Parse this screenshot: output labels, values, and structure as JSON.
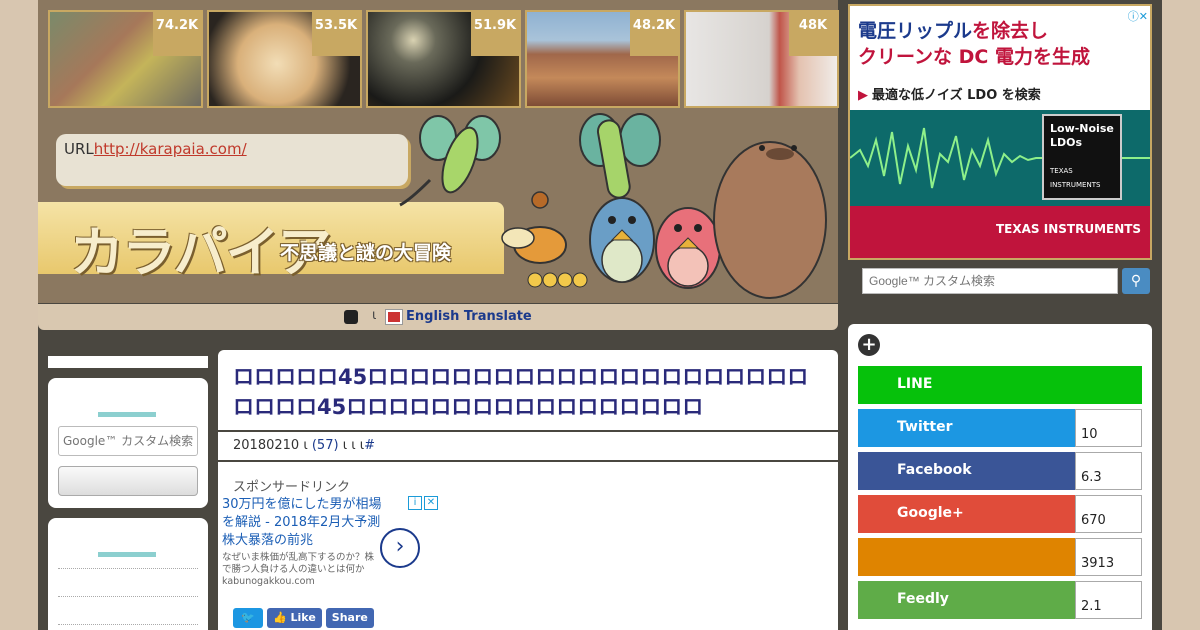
{
  "thumbs": [
    {
      "count": "74.2K",
      "icon": "street-photo"
    },
    {
      "count": "53.5K",
      "icon": "dog-photo"
    },
    {
      "count": "51.9K",
      "icon": "city-night-photo"
    },
    {
      "count": "48.2K",
      "icon": "canyon-photo"
    },
    {
      "count": "48K",
      "icon": "hand-device-photo"
    }
  ],
  "url_box": {
    "prefix": "URL",
    "link": "http://karapaia.com/"
  },
  "logo": {
    "title": "カラパイア",
    "tagline": "不思議と謎の大冒険"
  },
  "translate": {
    "separator": "ι",
    "label": "English Translate"
  },
  "left_sidebar": {
    "search_placeholder": "Google™ カスタム検索"
  },
  "article": {
    "title": "ロロロロロ45ロロロロロロロロロロロロロロロロロロロロロロロロロ45ロロロロロロロロロロロロロロロロロ",
    "date": "20180210",
    "comments": "(57)",
    "meta_tail": "ι ι ι",
    "meta_sep": "ι",
    "hash": "#",
    "sponsored": "スポンサードリンク",
    "ad": {
      "title": "30万円を億にした男が相場を解説 - 2018年2月大予測 株大暴落の前兆",
      "desc": "なぜいま株価が乱高下するのか？株で勝つ人負ける人の違いとは何か",
      "domain": "kabunogakkou.com",
      "arrow": "›"
    },
    "share_buttons": {
      "like": "Like",
      "share": "Share"
    }
  },
  "right_ad": {
    "line1_a": "電圧リップル",
    "line1_b": "を除去し",
    "line2": "クリーンな DC 電力を生成",
    "cta": "最適な低ノイズ LDO を検索",
    "chip_label": "Low-Noise LDOs",
    "chip_brand": "TEXAS INSTRUMENTS",
    "brand": "TEXAS INSTRUMENTS",
    "close": "ⓘ✕"
  },
  "right_search": {
    "placeholder": "Google™ カスタム検索",
    "button_icon": "search-icon"
  },
  "social": [
    {
      "name": "LINE",
      "count": "",
      "color": "#06c10b"
    },
    {
      "name": "Twitter",
      "count": "10",
      "color": "#1c97e2"
    },
    {
      "name": "Facebook",
      "count": "6.3",
      "color": "#3a5597"
    },
    {
      "name": "Google+",
      "count": "670",
      "color": "#e04c3a"
    },
    {
      "name": "",
      "count": "3913",
      "color": "#df8400"
    },
    {
      "name": "Feedly",
      "count": "2.1",
      "color": "#5fac48"
    }
  ]
}
